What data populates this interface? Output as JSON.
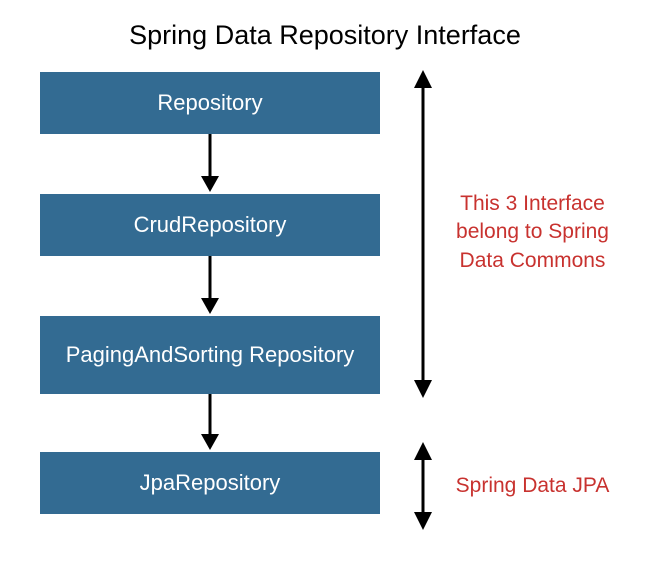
{
  "title": "Spring Data Repository Interface",
  "boxes": {
    "repository": "Repository",
    "crud": "CrudRepository",
    "paging": "PagingAndSorting Repository",
    "jpa": "JpaRepository"
  },
  "annotations": {
    "commons_line1": "This 3 Interface",
    "commons_line2": "belong to Spring",
    "commons_line3": "Data Commons",
    "jpa": "Spring Data JPA"
  },
  "colors": {
    "box_bg": "#336b92",
    "box_text": "#ffffff",
    "annotation": "#c8322f",
    "arrow": "#000000"
  }
}
